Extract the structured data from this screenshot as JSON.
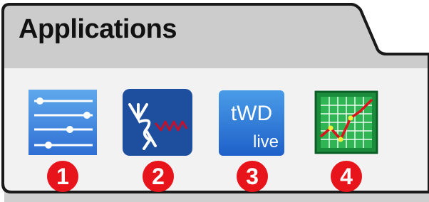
{
  "panel": {
    "title": "Applications"
  },
  "apps": [
    {
      "icon": "sliders-settings-icon",
      "badge": "1"
    },
    {
      "icon": "signal-waveform-app-icon",
      "badge": "2"
    },
    {
      "icon": "twd-live-icon",
      "badge": "3",
      "icon_text_top": "tWD",
      "icon_text_bottom": "live"
    },
    {
      "icon": "trend-chart-icon",
      "badge": "4"
    }
  ],
  "colors": {
    "panel_fill": "#f2f2f2",
    "tab_body": "#cccccc",
    "badge": "#e8141b",
    "app2_bg": "#1d4f9e",
    "app2_accent": "#c4102a",
    "app4_green": "#1a8c3c"
  }
}
